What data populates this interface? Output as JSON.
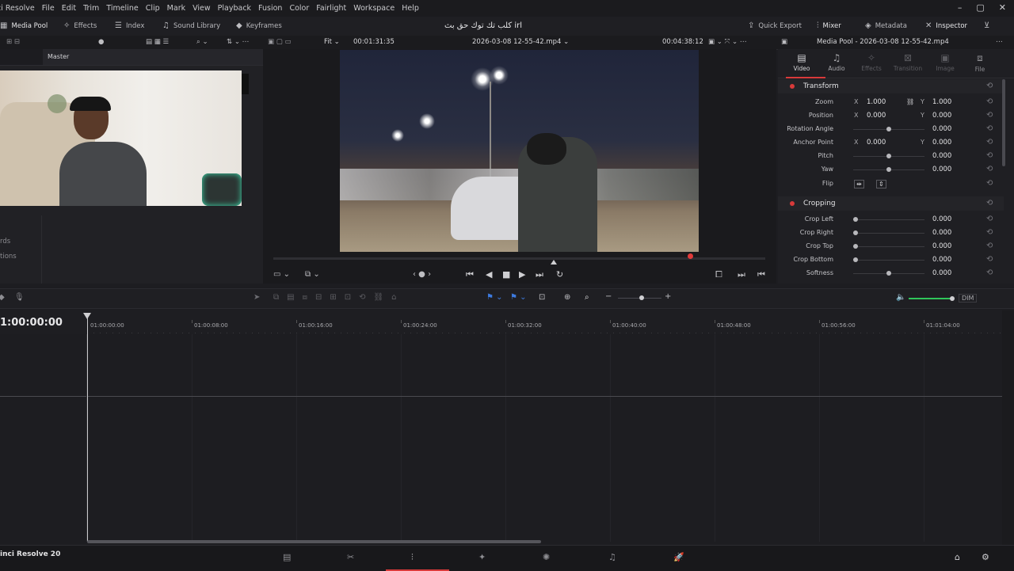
{
  "menu": {
    "app": "ci Resolve",
    "items": [
      "File",
      "Edit",
      "Trim",
      "Timeline",
      "Clip",
      "Mark",
      "View",
      "Playback",
      "Fusion",
      "Color",
      "Fairlight",
      "Workspace",
      "Help"
    ]
  },
  "window_controls": {
    "minimize": "–",
    "restore": "▢",
    "close": "✕"
  },
  "toolbar": {
    "media_pool": "Media Pool",
    "effects": "Effects",
    "index": "Index",
    "sound_library": "Sound Library",
    "keyframes": "Keyframes",
    "project_title": "كلب تك توك حق بث irl",
    "quick_export": "Quick Export",
    "mixer": "Mixer",
    "metadata": "Metadata",
    "inspector": "Inspector"
  },
  "viewer": {
    "zoom": "Fit",
    "timecode": "00:01:31:35",
    "clip_name": "2026-03-08 12-55-42.mp4",
    "duration": "00:04:38:12"
  },
  "media_pool": {
    "bin": "Master",
    "left_partial": [
      "rds",
      "tions"
    ]
  },
  "inspector": {
    "header": "Media Pool - 2026-03-08 12-55-42.mp4",
    "tabs": [
      {
        "label": "Video",
        "icon": "film-icon",
        "active": true
      },
      {
        "label": "Audio",
        "icon": "music-note-icon",
        "active": false
      },
      {
        "label": "Effects",
        "icon": "wand-icon",
        "active": false
      },
      {
        "label": "Transition",
        "icon": "transition-icon",
        "active": false
      },
      {
        "label": "Image",
        "icon": "image-icon",
        "active": false
      },
      {
        "label": "File",
        "icon": "file-icon",
        "active": false
      }
    ],
    "transform": {
      "title": "Transform",
      "zoom": {
        "label": "Zoom",
        "x": "1.000",
        "y": "1.000"
      },
      "position": {
        "label": "Position",
        "x": "0.000",
        "y": "0.000"
      },
      "rotation": {
        "label": "Rotation Angle",
        "value": "0.000",
        "slider": 0.5
      },
      "anchor": {
        "label": "Anchor Point",
        "x": "0.000",
        "y": "0.000"
      },
      "pitch": {
        "label": "Pitch",
        "value": "0.000",
        "slider": 0.5
      },
      "yaw": {
        "label": "Yaw",
        "value": "0.000",
        "slider": 0.5
      },
      "flip": {
        "label": "Flip"
      }
    },
    "cropping": {
      "title": "Cropping",
      "crop_left": {
        "label": "Crop Left",
        "value": "0.000",
        "slider": 0.0
      },
      "crop_right": {
        "label": "Crop Right",
        "value": "0.000",
        "slider": 0.0
      },
      "crop_top": {
        "label": "Crop Top",
        "value": "0.000",
        "slider": 0.0
      },
      "crop_bottom": {
        "label": "Crop Bottom",
        "value": "0.000",
        "slider": 0.0
      },
      "softness": {
        "label": "Softness",
        "value": "0.000",
        "slider": 0.5
      }
    },
    "axis_x": "X",
    "axis_y": "Y"
  },
  "timeline": {
    "current_timecode": "1:00:00:00",
    "dim_label": "DIM",
    "ticks": [
      "01:00:00:00",
      "01:00:08:00",
      "01:00:16:00",
      "01:00:24:00",
      "01:00:32:00",
      "01:00:40:00",
      "01:00:48:00",
      "01:00:56:00",
      "01:01:04:00"
    ]
  },
  "footer": {
    "app_name": "inci Resolve 20",
    "pages": [
      "media-page",
      "cut-page",
      "edit-page",
      "fusion-page",
      "color-page",
      "fairlight-page",
      "deliver-page"
    ],
    "active_page": "edit-page"
  }
}
